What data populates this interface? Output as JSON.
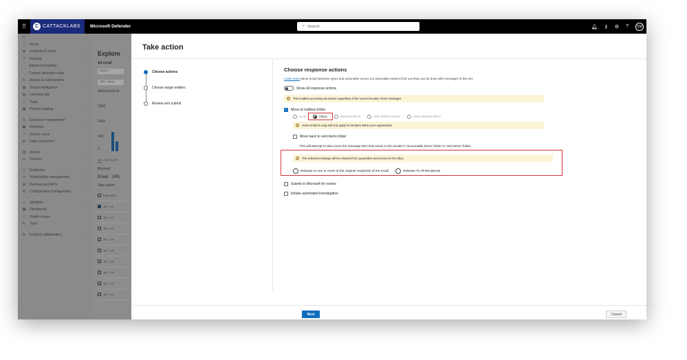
{
  "topbar": {
    "brand": "CATTACKLABS",
    "brand_mark": "C",
    "product": "Microsoft Defender",
    "search_placeholder": "Search",
    "avatar_initials": "SM"
  },
  "leftnav": {
    "items": [
      {
        "label": "Home",
        "icon": "home-icon"
      },
      {
        "label": "Incidents & alerts",
        "icon": "shield-icon",
        "chevron": true
      },
      {
        "label": "Hunting",
        "icon": "hunting-icon",
        "chevron": true
      },
      {
        "label": "Advanced hunting",
        "sub": true
      },
      {
        "label": "Custom detection rules",
        "sub": true
      },
      {
        "label": "Actions & submissions",
        "icon": "actions-icon",
        "chevron": true
      },
      {
        "label": "Threat intelligence",
        "icon": "intel-icon",
        "chevron": true
      },
      {
        "label": "Learning hub",
        "icon": "learning-icon"
      },
      {
        "label": "Trials",
        "icon": "trials-icon"
      },
      {
        "label": "Partner catalog",
        "icon": "catalog-icon",
        "chevron": true
      },
      {
        "gap": true
      },
      {
        "label": "Exposure management",
        "icon": "exposure-icon",
        "chevron": true
      },
      {
        "label": "Overview",
        "icon": "overview-icon"
      },
      {
        "label": "Secure score",
        "icon": "score-icon"
      },
      {
        "label": "Data connectors",
        "icon": "connectors-icon"
      },
      {
        "gap": true
      },
      {
        "label": "Assets",
        "icon": "assets-icon",
        "chevron": true
      },
      {
        "label": "Devices",
        "icon": "devices-icon"
      },
      {
        "gap": true
      },
      {
        "label": "Endpoints",
        "icon": "endpoints-icon",
        "chevron": true
      },
      {
        "label": "Vulnerability management",
        "icon": "vuln-icon",
        "chevron": true
      },
      {
        "label": "Partners and APIs",
        "icon": "partners-icon",
        "chevron": true
      },
      {
        "label": "Configuration management",
        "icon": "config-icon",
        "chevron": true
      },
      {
        "gap": true
      },
      {
        "label": "Identities",
        "icon": "identities-icon",
        "chevron": true
      },
      {
        "label": "Dashboard",
        "icon": "dashboard-icon"
      },
      {
        "label": "Health issues",
        "icon": "health-icon"
      },
      {
        "label": "Tools",
        "icon": "tools-icon"
      },
      {
        "gap": true
      },
      {
        "label": "Email & collaboration",
        "icon": "email-icon",
        "chevron": true
      }
    ]
  },
  "background": {
    "title": "Explore",
    "tab_all": "All email",
    "date_chip": "2024-0",
    "url_chip": "URL · Rece",
    "select_label": "Select pivot fo",
    "y_ticks": [
      "1000",
      "1500",
      "1000",
      "500",
      "0"
    ],
    "x_label": "Jul 4, 2024 11:30 PM",
    "legend": "Blocked",
    "tab_email": "Email",
    "tab_urls": "URL",
    "take_action": "Take action",
    "col_header": "Date (UTC",
    "rows": [
      "Jul 7, 20",
      "Jul 7, 20",
      "Jul 7, 20",
      "Jul 7, 20",
      "Jul 7, 20",
      "Jul 7, 20",
      "Jul 7, 20",
      "Jul 7, 20",
      "Jul 7, 20"
    ]
  },
  "panel": {
    "title": "Take action",
    "steps": [
      {
        "label": "Choose actions",
        "active": true
      },
      {
        "label": "Choose target entities",
        "active": false
      },
      {
        "label": "Review and submit",
        "active": false
      }
    ],
    "heading": "Choose response actions",
    "learn_more": "Learn more",
    "description": " about email selection types and actionable versus not actionable email to find out what can be done with messages in this set.",
    "show_all_label": "Show all response actions",
    "show_all_warning": "This enables accessing all actions regardless of the current location of the messages.",
    "move_to_mailbox_label": "Move to mailbox folder",
    "folder_options": [
      "Junk",
      "Inbox",
      "Deleted items",
      "Soft deleted items",
      "Hard deleted items"
    ],
    "selected_folder": "Inbox",
    "undo_warning": "Undo sender's copy will only apply for senders within your organization",
    "move_back_label": "Move back to sent items folder",
    "move_back_note": "This will attempt to also move the message item that exists in the sender's 'recoverable items' folder to 'sent items' folder",
    "release_warning": "The selected message will be released from quarantine and moved to the Inbox.",
    "release_option_1": "Release to one or more of the original recipients of the email",
    "release_option_2": "Release To All Recipients",
    "submit_label": "Submit to Microsoft for review",
    "investigation_label": "Initiate automated investigation",
    "next_label": "Next",
    "cancel_label": "Cancel"
  }
}
